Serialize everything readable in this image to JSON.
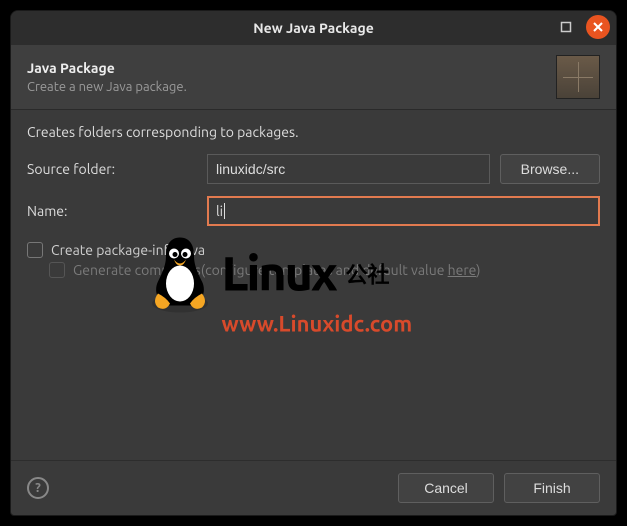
{
  "window": {
    "title": "New Java Package"
  },
  "banner": {
    "heading": "Java Package",
    "subheading": "Create a new Java package."
  },
  "content": {
    "description": "Creates folders corresponding to packages."
  },
  "form": {
    "source_folder": {
      "label": "Source folder:",
      "value": "linuxidc/src",
      "browse_label": "Browse..."
    },
    "name": {
      "label": "Name:",
      "value": "li"
    },
    "create_pkg_info": {
      "label": "Create package-info.java",
      "checked": false
    },
    "generate_comments": {
      "label_prefix": "Generate comments(configure templates and default value ",
      "link": "here",
      "label_suffix": ")",
      "enabled": false
    }
  },
  "footer": {
    "cancel": "Cancel",
    "finish": "Finish"
  },
  "watermark": {
    "brand": "Linux",
    "cn": "公社",
    "url": "www.Linuxidc.com"
  }
}
